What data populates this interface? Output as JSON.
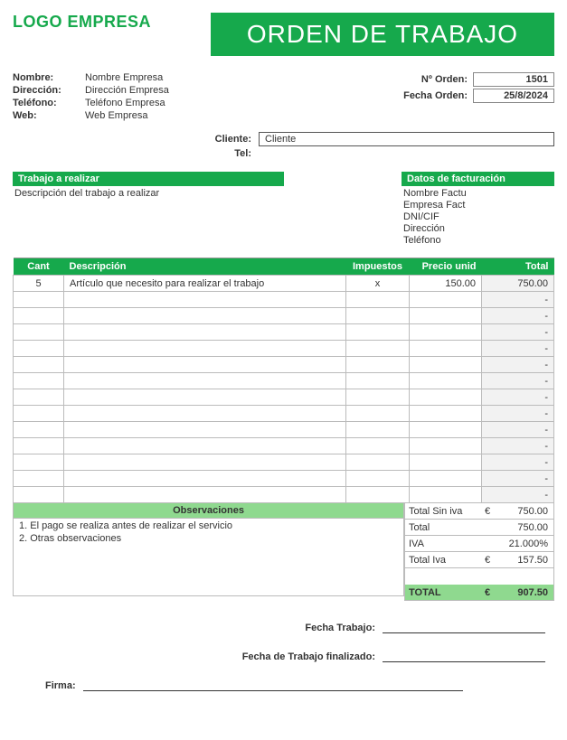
{
  "logo_text": "LOGO EMPRESA",
  "doc_title": "ORDEN DE TRABAJO",
  "company": {
    "name_label": "Nombre:",
    "name": "Nombre Empresa",
    "address_label": "Dirección:",
    "address": "Dirección Empresa",
    "phone_label": "Teléfono:",
    "phone": "Teléfono Empresa",
    "web_label": "Web:",
    "web": "Web Empresa"
  },
  "order": {
    "number_label": "Nº Orden:",
    "number": "1501",
    "date_label": "Fecha Orden:",
    "date": "25/8/2024"
  },
  "client": {
    "label": "Cliente:",
    "value": "Cliente",
    "tel_label": "Tel:",
    "tel_value": ""
  },
  "work_section": {
    "header": "Trabajo a realizar",
    "desc": "Descripción del trabajo a realizar"
  },
  "billing_section": {
    "header": "Datos de facturación",
    "lines": [
      "Nombre Factu",
      "Empresa Fact",
      "DNI/CIF",
      "Dirección",
      "Teléfono"
    ]
  },
  "items_header": {
    "qty": "Cant",
    "desc": "Descripción",
    "tax": "Impuestos",
    "unit": "Precio unid",
    "total": "Total"
  },
  "items": [
    {
      "qty": "5",
      "desc": "Artículo que necesito para realizar el trabajo",
      "tax": "x",
      "unit": "150.00",
      "total": "750.00"
    },
    {
      "qty": "",
      "desc": "",
      "tax": "",
      "unit": "",
      "total": "-"
    },
    {
      "qty": "",
      "desc": "",
      "tax": "",
      "unit": "",
      "total": "-"
    },
    {
      "qty": "",
      "desc": "",
      "tax": "",
      "unit": "",
      "total": "-"
    },
    {
      "qty": "",
      "desc": "",
      "tax": "",
      "unit": "",
      "total": "-"
    },
    {
      "qty": "",
      "desc": "",
      "tax": "",
      "unit": "",
      "total": "-"
    },
    {
      "qty": "",
      "desc": "",
      "tax": "",
      "unit": "",
      "total": "-"
    },
    {
      "qty": "",
      "desc": "",
      "tax": "",
      "unit": "",
      "total": "-"
    },
    {
      "qty": "",
      "desc": "",
      "tax": "",
      "unit": "",
      "total": "-"
    },
    {
      "qty": "",
      "desc": "",
      "tax": "",
      "unit": "",
      "total": "-"
    },
    {
      "qty": "",
      "desc": "",
      "tax": "",
      "unit": "",
      "total": "-"
    },
    {
      "qty": "",
      "desc": "",
      "tax": "",
      "unit": "",
      "total": "-"
    },
    {
      "qty": "",
      "desc": "",
      "tax": "",
      "unit": "",
      "total": "-"
    },
    {
      "qty": "",
      "desc": "",
      "tax": "",
      "unit": "",
      "total": "-"
    }
  ],
  "observations": {
    "header": "Observaciones",
    "lines": [
      "1. El pago se realiza antes de realizar el servicio",
      "2. Otras observaciones"
    ]
  },
  "totals": {
    "subtotal_label": "Total Sin iva",
    "subtotal_cur": "€",
    "subtotal_val": "750.00",
    "total_label": "Total",
    "total_val": "750.00",
    "iva_label": "IVA",
    "iva_val": "21.000%",
    "totaliva_label": "Total Iva",
    "totaliva_cur": "€",
    "totaliva_val": "157.50",
    "grand_label": "TOTAL",
    "grand_cur": "€",
    "grand_val": "907.50"
  },
  "signatures": {
    "work_date": "Fecha Trabajo:",
    "end_date": "Fecha de Trabajo finalizado:",
    "sign": "Firma:"
  }
}
